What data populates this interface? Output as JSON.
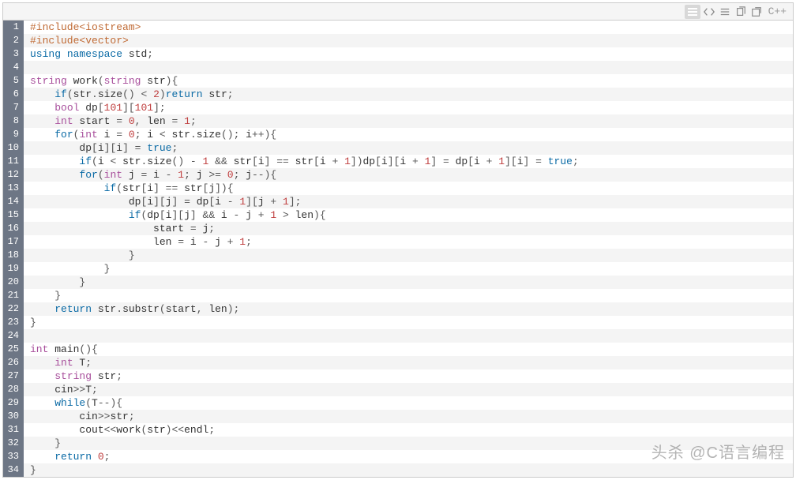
{
  "toolbar": {
    "language_label": "C++"
  },
  "watermark": "头杀 @C语言编程",
  "code_lines": [
    [
      [
        "pre",
        "#include<iostream>"
      ]
    ],
    [
      [
        "pre",
        "#include<vector>"
      ]
    ],
    [
      [
        "kw",
        "using"
      ],
      [
        "id",
        " "
      ],
      [
        "kw",
        "namespace"
      ],
      [
        "id",
        " std"
      ],
      [
        "op",
        ";"
      ]
    ],
    [],
    [
      [
        "type",
        "string"
      ],
      [
        "id",
        " work"
      ],
      [
        "op",
        "("
      ],
      [
        "type",
        "string"
      ],
      [
        "id",
        " str"
      ],
      [
        "op",
        "){"
      ]
    ],
    [
      [
        "id",
        "    "
      ],
      [
        "kw",
        "if"
      ],
      [
        "op",
        "("
      ],
      [
        "id",
        "str"
      ],
      [
        "op",
        "."
      ],
      [
        "id",
        "size"
      ],
      [
        "op",
        "() "
      ],
      [
        "op",
        "<"
      ],
      [
        "id",
        " "
      ],
      [
        "num",
        "2"
      ],
      [
        "op",
        ")"
      ],
      [
        "kw",
        "return"
      ],
      [
        "id",
        " str"
      ],
      [
        "op",
        ";"
      ]
    ],
    [
      [
        "id",
        "    "
      ],
      [
        "type",
        "bool"
      ],
      [
        "id",
        " dp"
      ],
      [
        "op",
        "["
      ],
      [
        "num",
        "101"
      ],
      [
        "op",
        "]["
      ],
      [
        "num",
        "101"
      ],
      [
        "op",
        "];"
      ]
    ],
    [
      [
        "id",
        "    "
      ],
      [
        "type",
        "int"
      ],
      [
        "id",
        " start "
      ],
      [
        "op",
        "="
      ],
      [
        "id",
        " "
      ],
      [
        "num",
        "0"
      ],
      [
        "op",
        ","
      ],
      [
        "id",
        " len "
      ],
      [
        "op",
        "="
      ],
      [
        "id",
        " "
      ],
      [
        "num",
        "1"
      ],
      [
        "op",
        ";"
      ]
    ],
    [
      [
        "id",
        "    "
      ],
      [
        "kw",
        "for"
      ],
      [
        "op",
        "("
      ],
      [
        "type",
        "int"
      ],
      [
        "id",
        " i "
      ],
      [
        "op",
        "="
      ],
      [
        "id",
        " "
      ],
      [
        "num",
        "0"
      ],
      [
        "op",
        ";"
      ],
      [
        "id",
        " i "
      ],
      [
        "op",
        "<"
      ],
      [
        "id",
        " str"
      ],
      [
        "op",
        "."
      ],
      [
        "id",
        "size"
      ],
      [
        "op",
        "();"
      ],
      [
        "id",
        " i"
      ],
      [
        "op",
        "++){"
      ]
    ],
    [
      [
        "id",
        "        dp"
      ],
      [
        "op",
        "["
      ],
      [
        "id",
        "i"
      ],
      [
        "op",
        "]["
      ],
      [
        "id",
        "i"
      ],
      [
        "op",
        "] = "
      ],
      [
        "bool",
        "true"
      ],
      [
        "op",
        ";"
      ]
    ],
    [
      [
        "id",
        "        "
      ],
      [
        "kw",
        "if"
      ],
      [
        "op",
        "("
      ],
      [
        "id",
        "i "
      ],
      [
        "op",
        "<"
      ],
      [
        "id",
        " str"
      ],
      [
        "op",
        "."
      ],
      [
        "id",
        "size"
      ],
      [
        "op",
        "() - "
      ],
      [
        "num",
        "1"
      ],
      [
        "id",
        " "
      ],
      [
        "op",
        "&&"
      ],
      [
        "id",
        " str"
      ],
      [
        "op",
        "["
      ],
      [
        "id",
        "i"
      ],
      [
        "op",
        "] == "
      ],
      [
        "id",
        "str"
      ],
      [
        "op",
        "["
      ],
      [
        "id",
        "i "
      ],
      [
        "op",
        "+"
      ],
      [
        "id",
        " "
      ],
      [
        "num",
        "1"
      ],
      [
        "op",
        "])"
      ],
      [
        "id",
        "dp"
      ],
      [
        "op",
        "["
      ],
      [
        "id",
        "i"
      ],
      [
        "op",
        "]["
      ],
      [
        "id",
        "i "
      ],
      [
        "op",
        "+"
      ],
      [
        "id",
        " "
      ],
      [
        "num",
        "1"
      ],
      [
        "op",
        "] = "
      ],
      [
        "id",
        "dp"
      ],
      [
        "op",
        "["
      ],
      [
        "id",
        "i "
      ],
      [
        "op",
        "+"
      ],
      [
        "id",
        " "
      ],
      [
        "num",
        "1"
      ],
      [
        "op",
        "]["
      ],
      [
        "id",
        "i"
      ],
      [
        "op",
        "] = "
      ],
      [
        "bool",
        "true"
      ],
      [
        "op",
        ";"
      ]
    ],
    [
      [
        "id",
        "        "
      ],
      [
        "kw",
        "for"
      ],
      [
        "op",
        "("
      ],
      [
        "type",
        "int"
      ],
      [
        "id",
        " j "
      ],
      [
        "op",
        "="
      ],
      [
        "id",
        " i "
      ],
      [
        "op",
        "-"
      ],
      [
        "id",
        " "
      ],
      [
        "num",
        "1"
      ],
      [
        "op",
        ";"
      ],
      [
        "id",
        " j "
      ],
      [
        "op",
        ">="
      ],
      [
        "id",
        " "
      ],
      [
        "num",
        "0"
      ],
      [
        "op",
        ";"
      ],
      [
        "id",
        " j"
      ],
      [
        "op",
        "--){"
      ]
    ],
    [
      [
        "id",
        "            "
      ],
      [
        "kw",
        "if"
      ],
      [
        "op",
        "("
      ],
      [
        "id",
        "str"
      ],
      [
        "op",
        "["
      ],
      [
        "id",
        "i"
      ],
      [
        "op",
        "] == "
      ],
      [
        "id",
        "str"
      ],
      [
        "op",
        "["
      ],
      [
        "id",
        "j"
      ],
      [
        "op",
        "]){"
      ]
    ],
    [
      [
        "id",
        "                dp"
      ],
      [
        "op",
        "["
      ],
      [
        "id",
        "i"
      ],
      [
        "op",
        "]["
      ],
      [
        "id",
        "j"
      ],
      [
        "op",
        "] = "
      ],
      [
        "id",
        "dp"
      ],
      [
        "op",
        "["
      ],
      [
        "id",
        "i "
      ],
      [
        "op",
        "-"
      ],
      [
        "id",
        " "
      ],
      [
        "num",
        "1"
      ],
      [
        "op",
        "]["
      ],
      [
        "id",
        "j "
      ],
      [
        "op",
        "+"
      ],
      [
        "id",
        " "
      ],
      [
        "num",
        "1"
      ],
      [
        "op",
        "];"
      ]
    ],
    [
      [
        "id",
        "                "
      ],
      [
        "kw",
        "if"
      ],
      [
        "op",
        "("
      ],
      [
        "id",
        "dp"
      ],
      [
        "op",
        "["
      ],
      [
        "id",
        "i"
      ],
      [
        "op",
        "]["
      ],
      [
        "id",
        "j"
      ],
      [
        "op",
        "] "
      ],
      [
        "op",
        "&&"
      ],
      [
        "id",
        " i "
      ],
      [
        "op",
        "-"
      ],
      [
        "id",
        " j "
      ],
      [
        "op",
        "+"
      ],
      [
        "id",
        " "
      ],
      [
        "num",
        "1"
      ],
      [
        "id",
        " "
      ],
      [
        "op",
        ">"
      ],
      [
        "id",
        " len"
      ],
      [
        "op",
        "){"
      ]
    ],
    [
      [
        "id",
        "                    start "
      ],
      [
        "op",
        "="
      ],
      [
        "id",
        " j"
      ],
      [
        "op",
        ";"
      ]
    ],
    [
      [
        "id",
        "                    len "
      ],
      [
        "op",
        "="
      ],
      [
        "id",
        " i "
      ],
      [
        "op",
        "-"
      ],
      [
        "id",
        " j "
      ],
      [
        "op",
        "+"
      ],
      [
        "id",
        " "
      ],
      [
        "num",
        "1"
      ],
      [
        "op",
        ";"
      ]
    ],
    [
      [
        "id",
        "                "
      ],
      [
        "op",
        "}"
      ]
    ],
    [
      [
        "id",
        "            "
      ],
      [
        "op",
        "}"
      ]
    ],
    [
      [
        "id",
        "        "
      ],
      [
        "op",
        "}"
      ]
    ],
    [
      [
        "id",
        "    "
      ],
      [
        "op",
        "}"
      ]
    ],
    [
      [
        "id",
        "    "
      ],
      [
        "kw",
        "return"
      ],
      [
        "id",
        " str"
      ],
      [
        "op",
        "."
      ],
      [
        "id",
        "substr"
      ],
      [
        "op",
        "("
      ],
      [
        "id",
        "start"
      ],
      [
        "op",
        ","
      ],
      [
        "id",
        " len"
      ],
      [
        "op",
        ");"
      ]
    ],
    [
      [
        "op",
        "}"
      ]
    ],
    [],
    [
      [
        "type",
        "int"
      ],
      [
        "id",
        " main"
      ],
      [
        "op",
        "(){"
      ]
    ],
    [
      [
        "id",
        "    "
      ],
      [
        "type",
        "int"
      ],
      [
        "id",
        " T"
      ],
      [
        "op",
        ";"
      ]
    ],
    [
      [
        "id",
        "    "
      ],
      [
        "type",
        "string"
      ],
      [
        "id",
        " str"
      ],
      [
        "op",
        ";"
      ]
    ],
    [
      [
        "id",
        "    cin"
      ],
      [
        "op",
        ">>"
      ],
      [
        "id",
        "T"
      ],
      [
        "op",
        ";"
      ]
    ],
    [
      [
        "id",
        "    "
      ],
      [
        "kw",
        "while"
      ],
      [
        "op",
        "("
      ],
      [
        "id",
        "T"
      ],
      [
        "op",
        "--){"
      ]
    ],
    [
      [
        "id",
        "        cin"
      ],
      [
        "op",
        ">>"
      ],
      [
        "id",
        "str"
      ],
      [
        "op",
        ";"
      ]
    ],
    [
      [
        "id",
        "        cout"
      ],
      [
        "op",
        "<<"
      ],
      [
        "id",
        "work"
      ],
      [
        "op",
        "("
      ],
      [
        "id",
        "str"
      ],
      [
        "op",
        ")"
      ],
      [
        "op",
        "<<"
      ],
      [
        "id",
        "endl"
      ],
      [
        "op",
        ";"
      ]
    ],
    [
      [
        "id",
        "    "
      ],
      [
        "op",
        "}"
      ]
    ],
    [
      [
        "id",
        "    "
      ],
      [
        "kw",
        "return"
      ],
      [
        "id",
        " "
      ],
      [
        "num",
        "0"
      ],
      [
        "op",
        ";"
      ]
    ],
    [
      [
        "op",
        "}"
      ]
    ]
  ]
}
